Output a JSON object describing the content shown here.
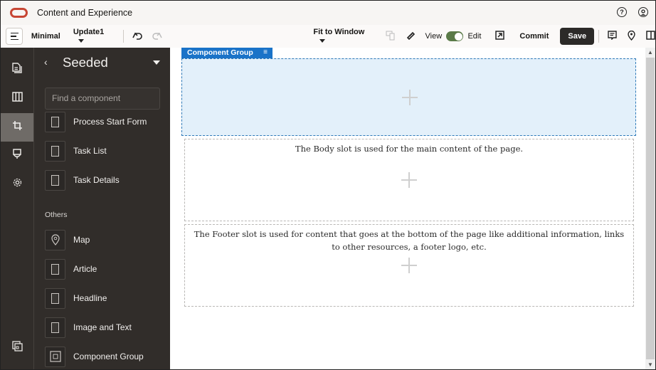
{
  "app": {
    "title": "Content and Experience",
    "brand_color": "#c74634"
  },
  "titlebar_icons": [
    "help-icon",
    "user-profile-icon"
  ],
  "toolbar": {
    "layout_label": "Minimal",
    "update_label": "Update1",
    "zoom_label": "Fit to Window",
    "view_label": "View",
    "edit_label": "Edit",
    "commit_label": "Commit",
    "save_label": "Save",
    "edit_toggle_on": true,
    "toggle_color": "#5a7a48"
  },
  "rail": {
    "items": [
      {
        "icon": "pages-icon"
      },
      {
        "icon": "layout-columns-icon"
      },
      {
        "icon": "components-crop-icon",
        "active": true
      },
      {
        "icon": "theme-brush-icon"
      },
      {
        "icon": "settings-gear-icon"
      },
      {
        "icon": "assets-icon"
      }
    ]
  },
  "panel": {
    "title": "Seeded",
    "search_placeholder": "Find a component",
    "components": [
      {
        "label": "Process Start Form"
      },
      {
        "label": "Task List"
      },
      {
        "label": "Task Details"
      }
    ],
    "others_label": "Others",
    "others": [
      {
        "label": "Map"
      },
      {
        "label": "Article"
      },
      {
        "label": "Headline"
      },
      {
        "label": "Image and Text"
      },
      {
        "label": "Component Group"
      }
    ]
  },
  "canvas": {
    "selected_label": "Component Group",
    "body_text": "The Body slot is used for the main content of the page.",
    "footer_text": "The Footer slot is used for content that goes at the bottom of the page like additional information, links to other resources, a footer logo, etc.",
    "accent_color": "#1a73c8"
  }
}
